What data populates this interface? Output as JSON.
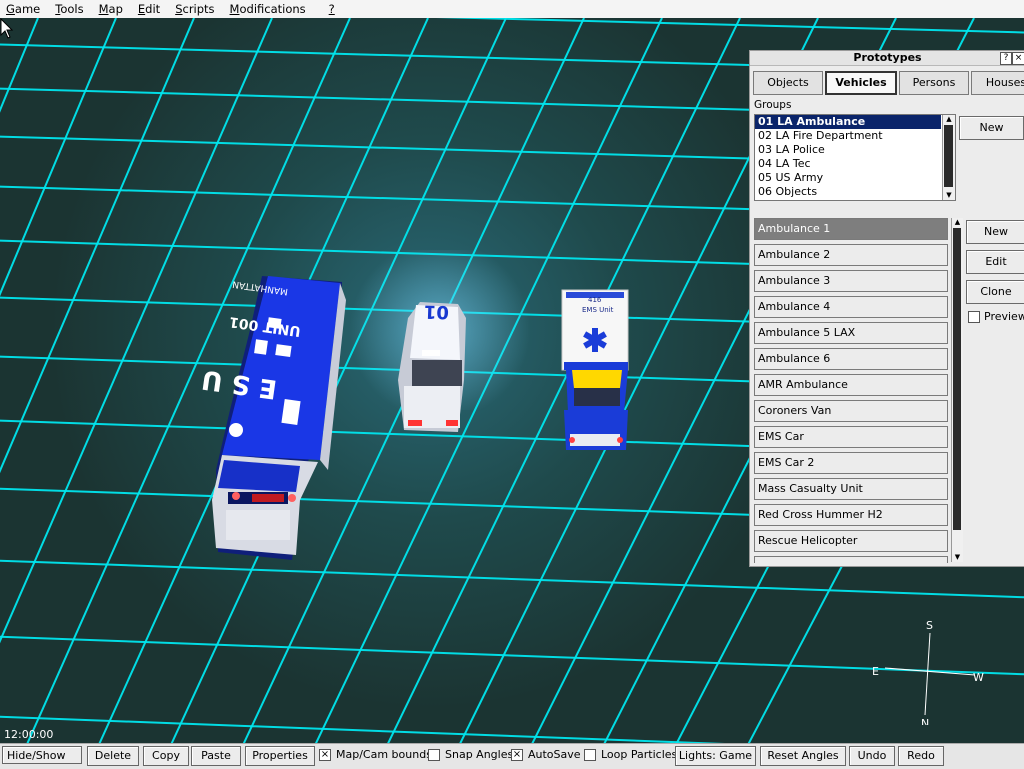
{
  "menu": [
    {
      "pre": "",
      "ul": "G",
      "post": "ame"
    },
    {
      "pre": "",
      "ul": "T",
      "post": "ools"
    },
    {
      "pre": "",
      "ul": "M",
      "post": "ap"
    },
    {
      "pre": "",
      "ul": "E",
      "post": "dit"
    },
    {
      "pre": "",
      "ul": "S",
      "post": "cripts"
    },
    {
      "pre": "",
      "ul": "M",
      "post": "odifications"
    },
    {
      "pre": "",
      "ul": "?",
      "post": ""
    }
  ],
  "viewport": {
    "clock": "12:00:00",
    "compass": {
      "n": "N",
      "s": "S",
      "e": "E",
      "w": "W"
    },
    "vehicles": {
      "truck_roof_text": "E S U",
      "truck_unit": "UNIT 001",
      "truck_roof_top": "MANHATTAN",
      "suv_number": "01",
      "ambulance_label": "EMS Unit",
      "ambulance_number": "416"
    },
    "colors": {
      "grid": "#00e6ee",
      "ground": "#1e3a38",
      "truck": "#1a37e6",
      "ambulance_stripe": "#ffd800"
    }
  },
  "panel": {
    "title": "Prototypes",
    "help": "?",
    "close": "×",
    "tabs": [
      {
        "label": "Objects",
        "active": false
      },
      {
        "label": "Vehicles",
        "active": true
      },
      {
        "label": "Persons",
        "active": false
      },
      {
        "label": "Houses",
        "active": false
      }
    ],
    "groups_label": "Groups",
    "groups": [
      "01 LA Ambulance",
      "02 LA Fire Department",
      "03 LA Police",
      "04 LA Tec",
      "05 US Army",
      "06 Objects"
    ],
    "groups_selected": 0,
    "new_group_label": "New",
    "vehicles": [
      "Ambulance 1",
      "Ambulance 2",
      "Ambulance 3",
      "Ambulance 4",
      "Ambulance 5 LAX",
      "Ambulance 6",
      "AMR Ambulance",
      "Coroners Van",
      "EMS Car",
      "EMS Car 2",
      "Mass Casualty Unit",
      "Red Cross Hummer H2",
      "Rescue Helicopter"
    ],
    "vehicles_selected": 0,
    "buttons": {
      "new": "New",
      "edit": "Edit",
      "clone": "Clone"
    },
    "previews": {
      "label": "Previews",
      "checked": false
    }
  },
  "toolbar": {
    "hide_show": "Hide/Show",
    "delete": "Delete",
    "copy": "Copy",
    "paste": "Paste",
    "properties": "Properties",
    "map_cam_bounds": {
      "label": "Map/Cam bounds",
      "checked": true
    },
    "snap_angles": {
      "label": "Snap Angles",
      "checked": false
    },
    "autosave": {
      "label": "AutoSave",
      "checked": true
    },
    "loop_particles": {
      "label": "Loop Particles",
      "checked": false
    },
    "lights": "Lights: Game",
    "reset_angles": "Reset Angles",
    "undo": "Undo",
    "redo": "Redo"
  }
}
